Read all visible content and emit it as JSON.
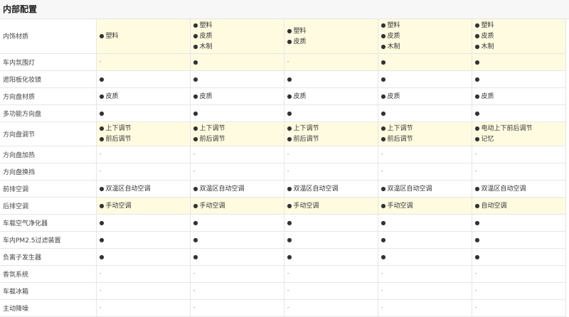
{
  "section": {
    "title": "内部配置"
  },
  "rows": [
    {
      "label": "内饰材质",
      "highlight": true,
      "height": 48,
      "cells": [
        [
          "塑料"
        ],
        [
          "塑料",
          "皮质",
          "木制"
        ],
        [
          "塑料",
          "皮质"
        ],
        [
          "塑料",
          "皮质",
          "木制"
        ],
        [
          "塑料",
          "皮质",
          "木制"
        ]
      ]
    },
    {
      "label": "车内氛围灯",
      "highlight": true,
      "height": 24,
      "cells": [
        "-",
        [
          ""
        ],
        "-",
        [
          ""
        ],
        [
          ""
        ]
      ]
    },
    {
      "label": "遮阳板化妆镜",
      "highlight": false,
      "height": 24,
      "cells": [
        [
          ""
        ],
        [
          ""
        ],
        [
          ""
        ],
        [
          ""
        ],
        [
          ""
        ]
      ]
    },
    {
      "label": "方向盘材质",
      "highlight": false,
      "height": 24,
      "cells": [
        [
          "皮质"
        ],
        [
          "皮质"
        ],
        [
          "皮质"
        ],
        [
          "皮质"
        ],
        [
          "皮质"
        ]
      ]
    },
    {
      "label": "多功能方向盘",
      "highlight": false,
      "height": 24,
      "cells": [
        [
          ""
        ],
        [
          ""
        ],
        [
          ""
        ],
        [
          ""
        ],
        [
          ""
        ]
      ]
    },
    {
      "label": "方向盘调节",
      "highlight": true,
      "height": 34,
      "cells": [
        [
          "上下调节",
          "前后调节"
        ],
        [
          "上下调节",
          "前后调节"
        ],
        [
          "上下调节",
          "前后调节"
        ],
        [
          "上下调节",
          "前后调节"
        ],
        [
          "电动上下前后调节",
          "记忆"
        ]
      ]
    },
    {
      "label": "方向盘加热",
      "highlight": false,
      "height": 24,
      "cells": [
        "-",
        "-",
        "-",
        "-",
        "-"
      ]
    },
    {
      "label": "方向盘换挡",
      "highlight": false,
      "height": 24,
      "cells": [
        "-",
        "-",
        "-",
        "-",
        "-"
      ]
    },
    {
      "label": "前排空调",
      "highlight": false,
      "height": 24,
      "cells": [
        [
          "双温区自动空调"
        ],
        [
          "双温区自动空调"
        ],
        [
          "双温区自动空调"
        ],
        [
          "双温区自动空调"
        ],
        [
          "双温区自动空调"
        ]
      ]
    },
    {
      "label": "后排空调",
      "highlight": true,
      "height": 24,
      "cells": [
        [
          "手动空调"
        ],
        [
          "手动空调"
        ],
        [
          "手动空调"
        ],
        [
          "手动空调"
        ],
        [
          "自动空调"
        ]
      ]
    },
    {
      "label": "车载空气净化器",
      "highlight": false,
      "height": 24,
      "cells": [
        [
          ""
        ],
        [
          ""
        ],
        [
          ""
        ],
        [
          ""
        ],
        [
          ""
        ]
      ]
    },
    {
      "label": "车内PM2.5过滤装置",
      "highlight": false,
      "height": 24,
      "cells": [
        [
          ""
        ],
        [
          ""
        ],
        [
          ""
        ],
        [
          ""
        ],
        [
          ""
        ]
      ]
    },
    {
      "label": "负离子发生器",
      "highlight": false,
      "height": 24,
      "cells": [
        [
          ""
        ],
        [
          ""
        ],
        [
          ""
        ],
        [
          ""
        ],
        [
          ""
        ]
      ]
    },
    {
      "label": "香氛系统",
      "highlight": false,
      "height": 24,
      "cells": [
        "-",
        "-",
        "-",
        "-",
        "-"
      ]
    },
    {
      "label": "车载冰箱",
      "highlight": false,
      "height": 24,
      "cells": [
        "-",
        "-",
        "-",
        "-",
        "-"
      ]
    },
    {
      "label": "主动降噪",
      "highlight": false,
      "height": 24,
      "cells": [
        "-",
        "-",
        "-",
        "-",
        "-"
      ]
    }
  ]
}
